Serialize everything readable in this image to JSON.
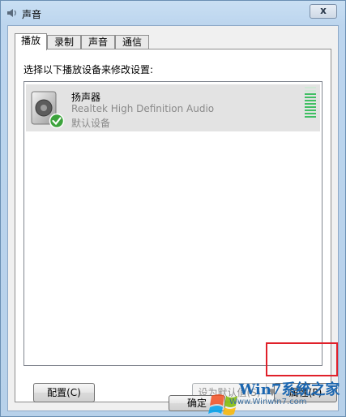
{
  "window": {
    "title": "声音",
    "close_label": "x"
  },
  "tabs": [
    {
      "label": "播放",
      "active": true
    },
    {
      "label": "录制",
      "active": false
    },
    {
      "label": "声音",
      "active": false
    },
    {
      "label": "通信",
      "active": false
    }
  ],
  "panel": {
    "instruction": "选择以下播放设备来修改设置:"
  },
  "devices": [
    {
      "name": "扬声器",
      "description": "Realtek High Definition Audio",
      "status": "默认设备",
      "icon": "speaker-icon",
      "badge_icon": "green-check-icon",
      "level": 0.8
    }
  ],
  "buttons": {
    "configure": "配置(C)",
    "set_default": "设为默认值(S)",
    "properties": "属性(P)",
    "ok": "确定"
  },
  "watermark": {
    "site": "Win7系统之家",
    "url": "Www.Winwin7.com"
  },
  "colors": {
    "highlight": "#e0202a",
    "selection": "#e3e3e3",
    "meter": "#3fbf63"
  }
}
